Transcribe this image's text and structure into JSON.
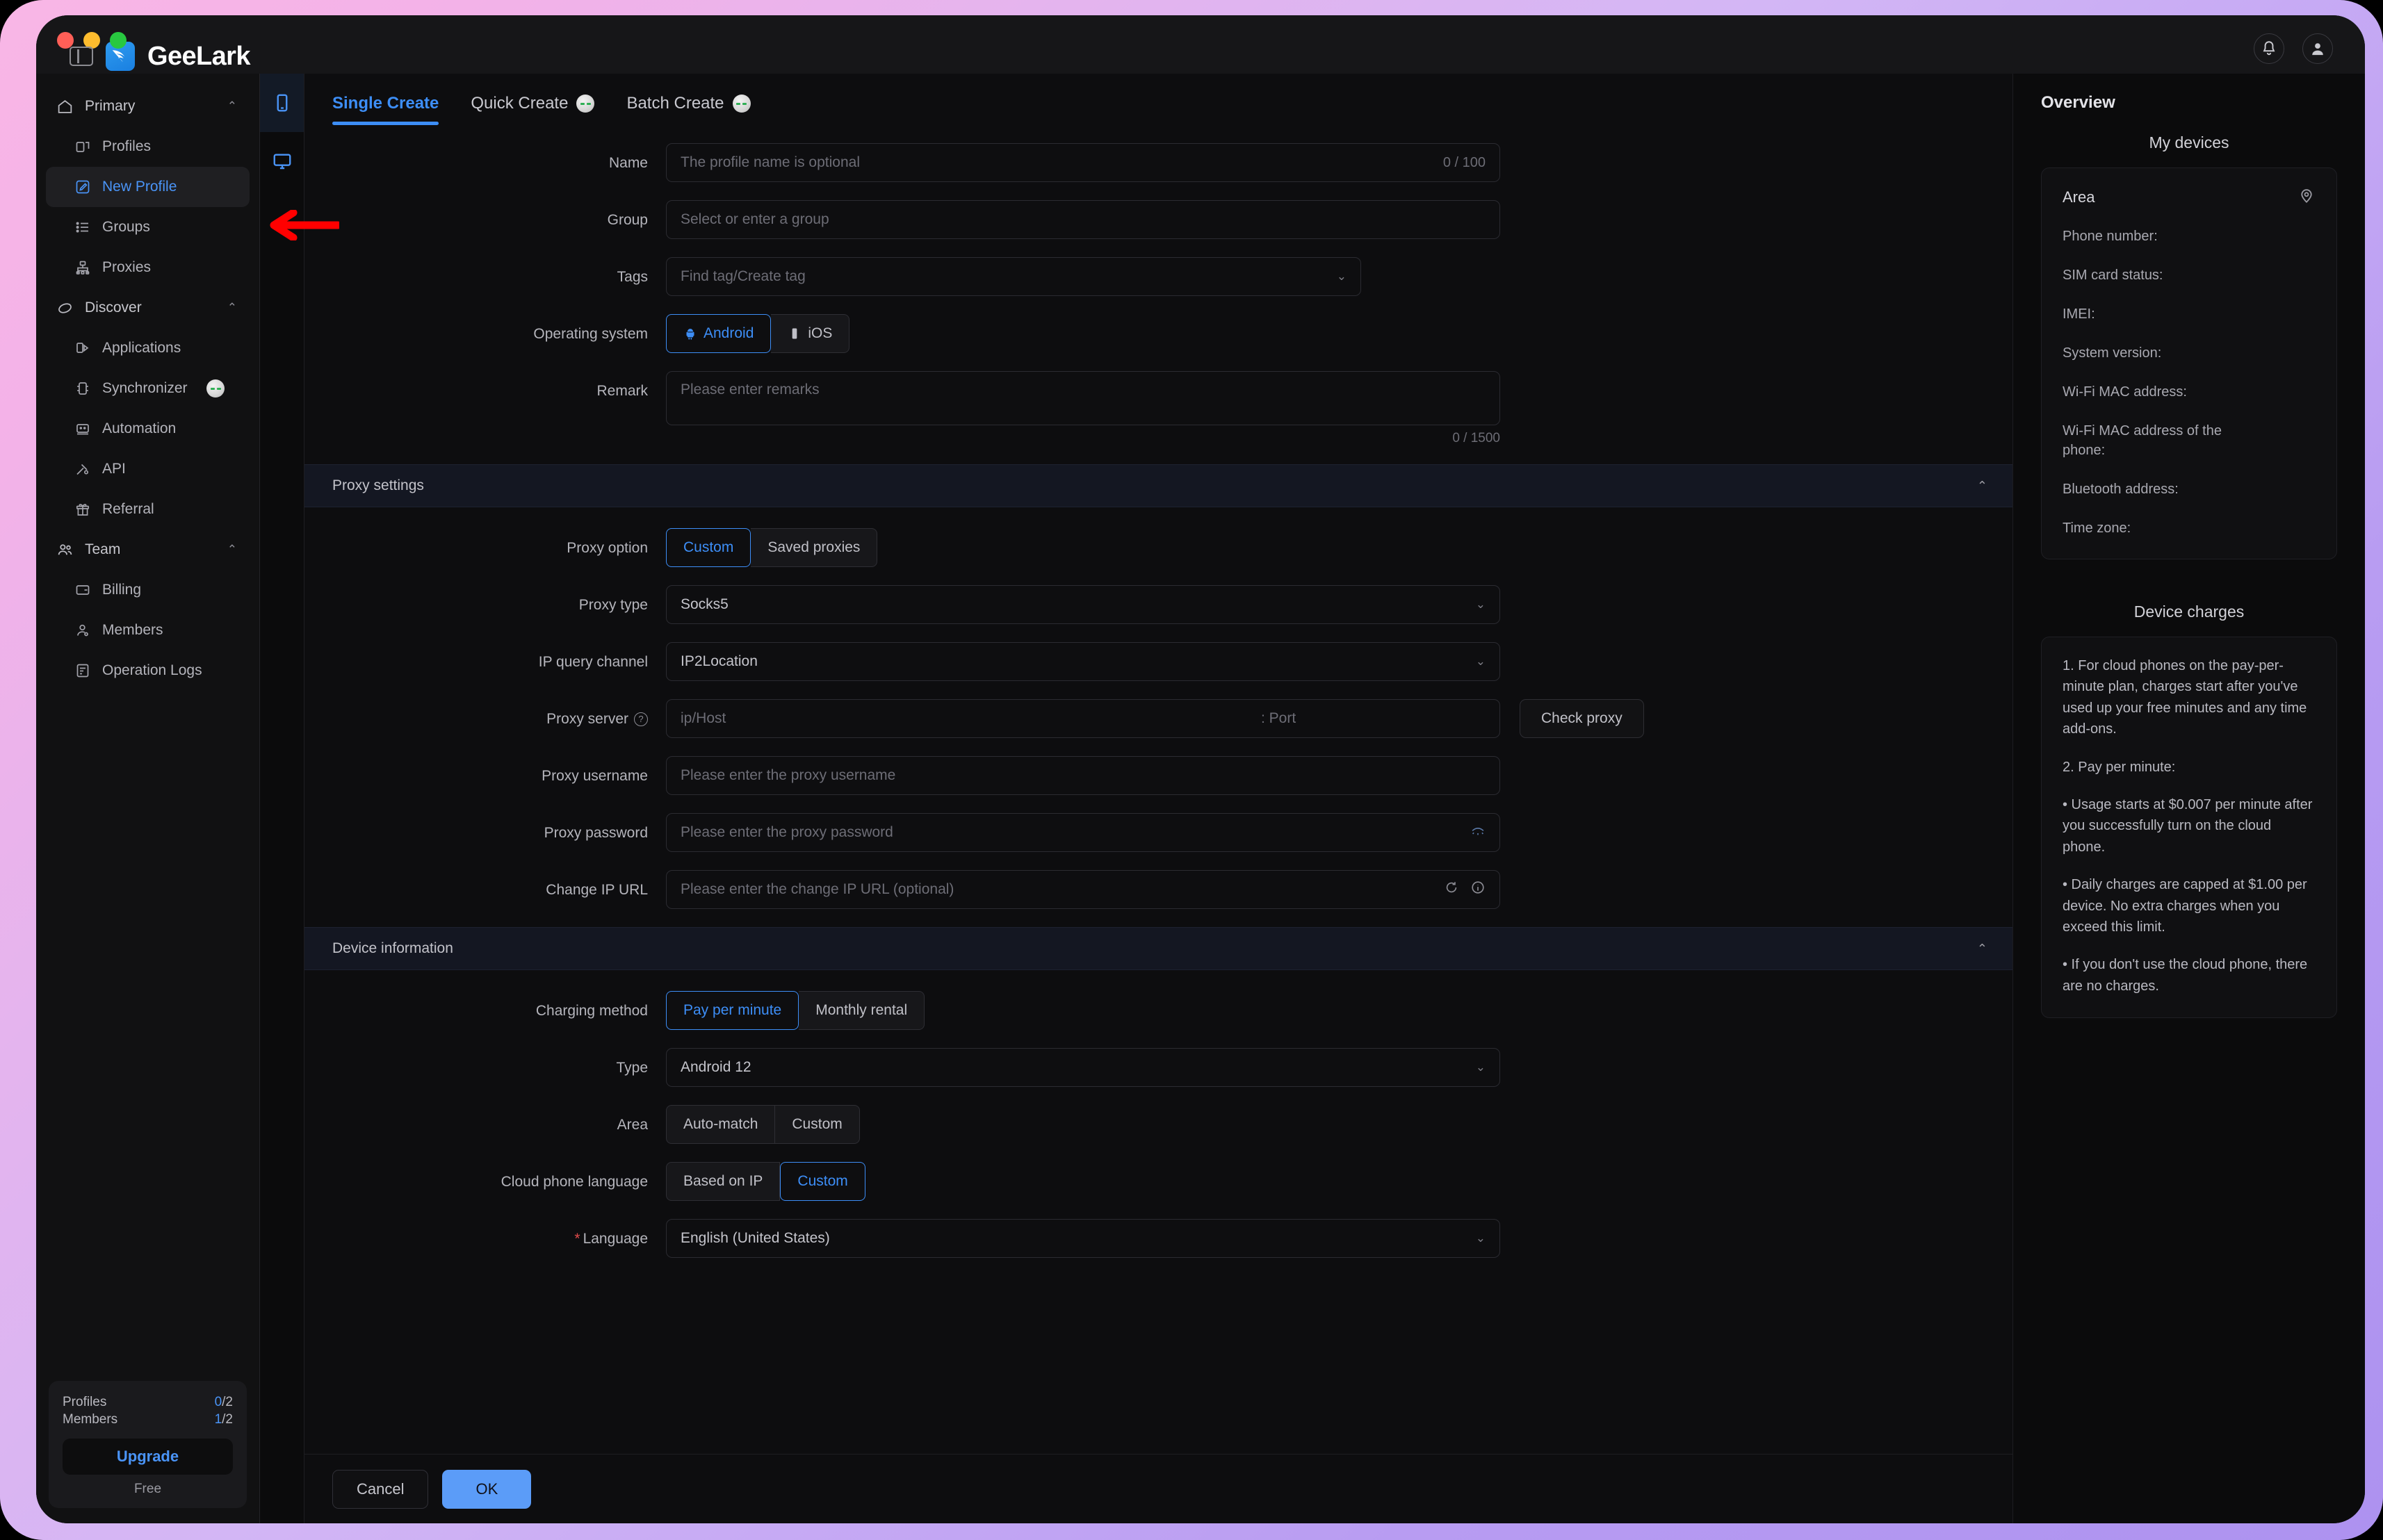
{
  "window": {
    "app_name": "GeeLark"
  },
  "titlebar": {
    "toggle_icon": "panel-toggle-icon",
    "notification_icon": "bell-icon",
    "account_icon": "user-avatar-icon"
  },
  "sidebar": {
    "groups": [
      {
        "label": "Primary",
        "icon": "home-icon",
        "chevron": "⌃",
        "items": [
          {
            "label": "Profiles",
            "icon": "profiles-icon",
            "active": false
          },
          {
            "label": "New Profile",
            "icon": "edit-square-icon",
            "active": true
          },
          {
            "label": "Groups",
            "icon": "list-icon",
            "active": false
          },
          {
            "label": "Proxies",
            "icon": "network-icon",
            "active": false
          }
        ]
      },
      {
        "label": "Discover",
        "icon": "compass-icon",
        "chevron": "⌃",
        "items": [
          {
            "label": "Applications",
            "icon": "apps-icon",
            "active": false
          },
          {
            "label": "Synchronizer",
            "icon": "sync-icon",
            "active": false,
            "badge": true
          },
          {
            "label": "Automation",
            "icon": "robot-icon",
            "active": false
          },
          {
            "label": "API",
            "icon": "api-icon",
            "active": false
          },
          {
            "label": "Referral",
            "icon": "gift-icon",
            "active": false
          }
        ]
      },
      {
        "label": "Team",
        "icon": "team-icon",
        "chevron": "⌃",
        "items": [
          {
            "label": "Billing",
            "icon": "card-icon",
            "active": false
          },
          {
            "label": "Members",
            "icon": "person-icon",
            "active": false
          },
          {
            "label": "Operation Logs",
            "icon": "log-icon",
            "active": false
          }
        ]
      }
    ],
    "plan": {
      "profiles_label": "Profiles",
      "profiles_value": "0",
      "profiles_total": "/2",
      "members_label": "Members",
      "members_value": "1",
      "members_total": "/2",
      "upgrade_label": "Upgrade",
      "tier_label": "Free"
    }
  },
  "rail": {
    "items": [
      {
        "icon": "phone-icon",
        "selected": true
      },
      {
        "icon": "monitor-icon",
        "selected": false
      }
    ]
  },
  "tabs": [
    {
      "label": "Single Create",
      "active": true,
      "badge": false
    },
    {
      "label": "Quick Create",
      "active": false,
      "badge": true
    },
    {
      "label": "Batch Create",
      "active": false,
      "badge": true
    }
  ],
  "form": {
    "name": {
      "label": "Name",
      "placeholder": "The profile name is optional",
      "value": "",
      "counter": "0 / 100"
    },
    "group": {
      "label": "Group",
      "placeholder": "Select or enter a group",
      "value": ""
    },
    "tags": {
      "label": "Tags",
      "placeholder": "Find tag/Create tag",
      "value": "",
      "chevron": "⌄"
    },
    "os": {
      "label": "Operating system",
      "options": [
        {
          "label": "Android",
          "icon": "android-icon",
          "selected": true
        },
        {
          "label": "iOS",
          "icon": "apple-phone-icon",
          "selected": false
        }
      ]
    },
    "remark": {
      "label": "Remark",
      "placeholder": "Please enter remarks",
      "value": "",
      "counter": "0 / 1500"
    }
  },
  "proxy_section": {
    "title": "Proxy settings",
    "chevron": "⌃",
    "option": {
      "label": "Proxy option",
      "options": [
        {
          "label": "Custom",
          "selected": true
        },
        {
          "label": "Saved proxies",
          "selected": false
        }
      ]
    },
    "type": {
      "label": "Proxy type",
      "value": "Socks5",
      "chevron": "⌄"
    },
    "ip_query": {
      "label": "IP query channel",
      "value": "IP2Location",
      "chevron": "⌄"
    },
    "server": {
      "label": "Proxy server",
      "help_icon": "question-mark-icon",
      "host_placeholder": "ip/Host",
      "port_placeholder": ": Port",
      "host_value": "",
      "port_value": "",
      "check_button": "Check proxy"
    },
    "username": {
      "label": "Proxy username",
      "placeholder": "Please enter the proxy username",
      "value": ""
    },
    "password": {
      "label": "Proxy password",
      "placeholder": "Please enter the proxy password",
      "value": "",
      "eye_icon": "eye-off-icon"
    },
    "change_ip": {
      "label": "Change IP URL",
      "placeholder": "Please enter the change IP URL (optional)",
      "value": "",
      "refresh_icon": "refresh-icon",
      "info_icon": "info-icon"
    }
  },
  "device_section": {
    "title": "Device information",
    "chevron": "⌃",
    "charging": {
      "label": "Charging method",
      "options": [
        {
          "label": "Pay per minute",
          "selected": true
        },
        {
          "label": "Monthly rental",
          "selected": false
        }
      ]
    },
    "type": {
      "label": "Type",
      "value": "Android 12",
      "chevron": "⌄"
    },
    "area": {
      "label": "Area",
      "options": [
        {
          "label": "Auto-match",
          "selected": false
        },
        {
          "label": "Custom",
          "selected": false
        }
      ]
    },
    "cloud_language": {
      "label": "Cloud phone language",
      "options": [
        {
          "label": "Based on IP",
          "selected": false
        },
        {
          "label": "Custom",
          "selected": true
        }
      ]
    },
    "language": {
      "label": "Language",
      "required": true,
      "value": "English (United States)",
      "chevron": "⌄"
    }
  },
  "footer": {
    "cancel_label": "Cancel",
    "ok_label": "OK"
  },
  "overview": {
    "title": "Overview",
    "devices_heading": "My devices",
    "area_label": "Area",
    "area_icon": "location-pin-icon",
    "fields": [
      "Phone number:",
      "SIM card status:",
      "IMEI:",
      "System version:",
      "Wi-Fi MAC address:",
      "Wi-Fi MAC address of the phone:",
      "Bluetooth address:",
      "Time zone:"
    ],
    "charges_heading": "Device charges",
    "charges": [
      "1. For cloud phones on the pay-per-minute plan, charges start after you've used up your free minutes and any time add-ons.",
      "2. Pay per minute:",
      "• Usage starts at $0.007 per minute after you successfully turn on the cloud phone.",
      "• Daily charges are capped at $1.00 per device. No extra charges when you exceed this limit.",
      "• If you don't use the cloud phone, there are no charges."
    ]
  },
  "annotation": {
    "arrow_color": "#ff0000",
    "points_to": "New Profile"
  }
}
